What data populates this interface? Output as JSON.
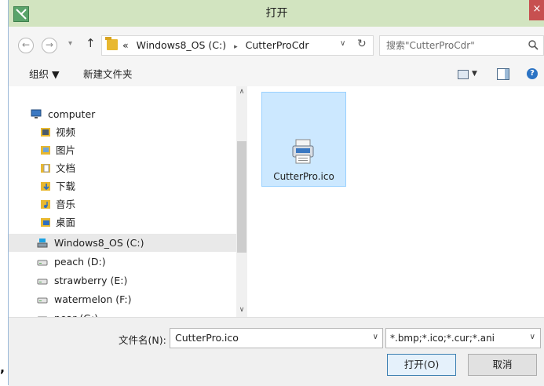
{
  "window": {
    "title": "打开",
    "close_glyph": "×"
  },
  "address": {
    "back_glyph": "←",
    "forward_glyph": "→",
    "recent_glyph": "▾",
    "up_glyph": "↑",
    "overflow_glyph": "«",
    "separator_glyph": "▸",
    "crumbs": [
      "Windows8_OS (C:)",
      "CutterProCdr"
    ],
    "dropdown_glyph": "∨",
    "refresh_glyph": "↻",
    "search_placeholder": "搜索\"CutterProCdr\""
  },
  "toolbar": {
    "organize": "组织 ▼",
    "new_folder": "新建文件夹",
    "view_dd_glyph": "▼",
    "help_glyph": "?"
  },
  "nav": {
    "items": [
      {
        "label": "computer",
        "icon": "computer-icon"
      },
      {
        "label": "视频",
        "icon": "videos-folder-icon"
      },
      {
        "label": "图片",
        "icon": "pictures-folder-icon"
      },
      {
        "label": "文档",
        "icon": "documents-folder-icon"
      },
      {
        "label": "下载",
        "icon": "downloads-folder-icon"
      },
      {
        "label": "音乐",
        "icon": "music-folder-icon"
      },
      {
        "label": "桌面",
        "icon": "desktop-folder-icon"
      },
      {
        "label": "Windows8_OS (C:)",
        "icon": "system-drive-icon",
        "selected": true
      },
      {
        "label": "peach (D:)",
        "icon": "drive-icon"
      },
      {
        "label": "strawberry (E:)",
        "icon": "drive-icon"
      },
      {
        "label": "watermelon (F:)",
        "icon": "drive-icon"
      },
      {
        "label": "pear (G:)",
        "icon": "drive-icon"
      }
    ],
    "scroll_up_glyph": "∧",
    "scroll_down_glyph": "∨"
  },
  "files": [
    {
      "name": "CutterPro.ico",
      "icon": "ico-file-icon",
      "selected": true
    }
  ],
  "bottom": {
    "filename_label": "文件名(N):",
    "filename_value": "CutterPro.ico",
    "filename_dd_glyph": "∨",
    "filter_value": "*.bmp;*.ico;*.cur;*.ani",
    "filter_dd_glyph": "∨",
    "open_label": "打开(O)",
    "cancel_label": "取消"
  },
  "stray_mark": ",",
  "colors": {
    "titlebar": "#d2e4c0",
    "selection_fill": "#cce8ff",
    "selection_border": "#99d1ff",
    "close": "#c75050",
    "open_border": "#3c7fb1"
  }
}
